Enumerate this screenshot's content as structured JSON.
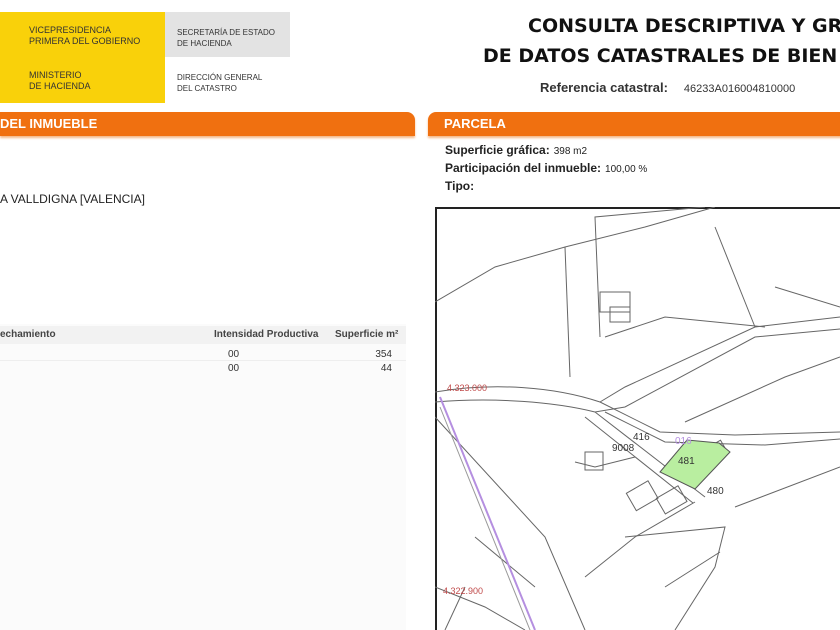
{
  "header": {
    "logo": {
      "line1a": "VICEPRESIDENCIA",
      "line1b": "PRIMERA DEL GOBIERNO",
      "line2a": "MINISTERIO",
      "line2b": "DE HACIENDA",
      "sec1a": "SECRETARÍA DE ESTADO",
      "sec1b": "DE HACIENDA",
      "sec2a": "DIRECCIÓN GENERAL",
      "sec2b": "DEL CATASTRO"
    },
    "title_line1": "CONSULTA DESCRIPTIVA Y GR",
    "title_line2": "DE DATOS CATASTRALES DE BIEN",
    "ref_label": "Referencia catastral:",
    "ref_value": "46233A016004810000"
  },
  "left": {
    "section_title": "DEL INMUEBLE",
    "location": "A VALLDIGNA [VALENCIA]",
    "table": {
      "headers": [
        "echamiento",
        "Intensidad Productiva",
        "Superficie m²"
      ],
      "rows": [
        {
          "intensidad": "00",
          "superficie": "354"
        },
        {
          "intensidad": "00",
          "superficie": "44"
        }
      ]
    }
  },
  "right": {
    "section_title": "PARCELA",
    "superficie_label": "Superficie gráfica:",
    "superficie_value": "398 m2",
    "participacion_label": "Participación del inmueble:",
    "participacion_value": "100,00 %",
    "tipo_label": "Tipo:",
    "map": {
      "coord_top": "4.323.000",
      "coord_bottom": "4.322.900",
      "labels": [
        "416",
        "9008",
        "016",
        "481",
        "480"
      ],
      "highlight_color": "#b9eea0"
    }
  }
}
